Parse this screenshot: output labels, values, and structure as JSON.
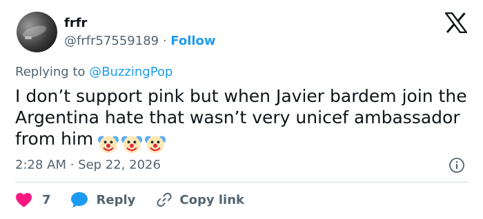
{
  "author": {
    "display_name": "frfr",
    "handle": "@frfr57559189",
    "separator": " · ",
    "follow_label": "Follow"
  },
  "reply_context": {
    "prefix": "Replying to ",
    "mention": "@BuzzingPop"
  },
  "tweet": {
    "text": "I don’t support pink but when Javier bardem join the Argentina hate that wasn’t very unicef ambassador from him",
    "emojis": [
      "clown-face-icon",
      "clown-face-icon",
      "clown-face-icon"
    ],
    "timestamp": "2:28 AM · Sep 22, 2026"
  },
  "actions": {
    "like_count": "7",
    "reply_label": "Reply",
    "copy_link_label": "Copy link"
  },
  "colors": {
    "accent": "#1d9bf0",
    "heart": "#f91880",
    "secondary_text": "#536471",
    "primary_text": "#0f1419",
    "divider": "#cfd9de"
  },
  "icons": [
    "x-logo-icon",
    "info-icon",
    "heart-icon",
    "reply-bubble-icon",
    "link-icon"
  ]
}
